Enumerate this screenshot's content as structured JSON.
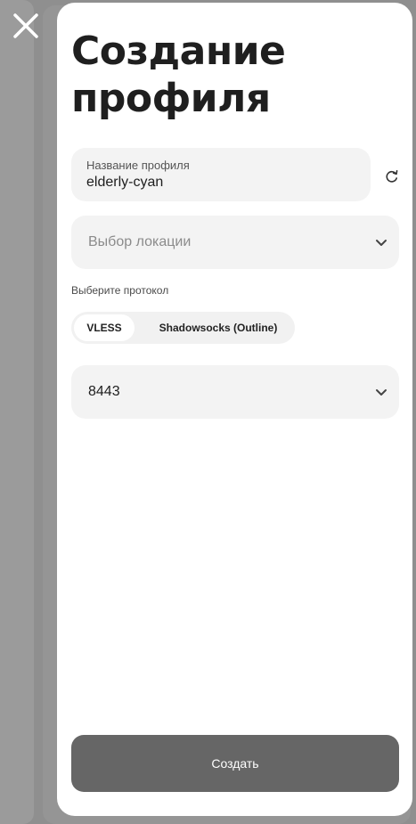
{
  "title": "Создание профиля",
  "name_field": {
    "label": "Название профиля",
    "value": "elderly-cyan"
  },
  "location_select": {
    "placeholder": "Выбор локации"
  },
  "protocol": {
    "label": "Выберите протокол",
    "options": [
      "VLESS",
      "Shadowsocks (Outline)"
    ],
    "selected": "VLESS"
  },
  "port_select": {
    "value": "8443"
  },
  "create_button": {
    "label": "Создать"
  },
  "icons": {
    "close": "close-icon",
    "regenerate": "refresh-icon",
    "dropdown": "chevron-down-icon"
  },
  "colors": {
    "overlay": "#8f8f8f",
    "sheet": "#ffffff",
    "field_bg": "#f3f3f3",
    "button_bg": "#666666",
    "text": "#1f1f1f"
  }
}
